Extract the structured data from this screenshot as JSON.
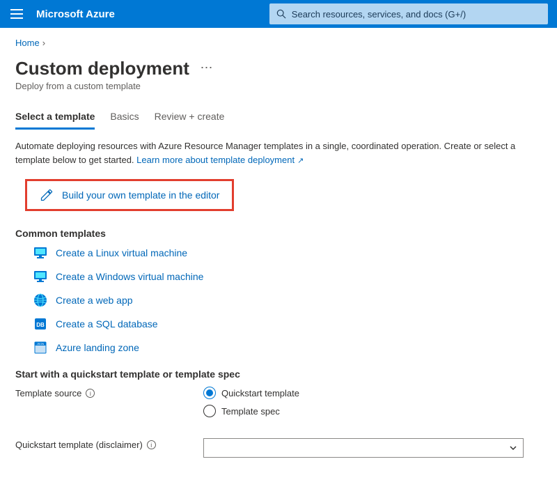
{
  "header": {
    "brand": "Microsoft Azure",
    "search_placeholder": "Search resources, services, and docs (G+/)"
  },
  "breadcrumb": {
    "home": "Home"
  },
  "page": {
    "title": "Custom deployment",
    "subtitle": "Deploy from a custom template"
  },
  "tabs": [
    {
      "label": "Select a template",
      "active": true
    },
    {
      "label": "Basics",
      "active": false
    },
    {
      "label": "Review + create",
      "active": false
    }
  ],
  "intro": {
    "text": "Automate deploying resources with Azure Resource Manager templates in a single, coordinated operation. Create or select a template below to get started.  ",
    "link": "Learn more about template deployment"
  },
  "build_link": "Build your own template in the editor",
  "common_templates_head": "Common templates",
  "templates": [
    {
      "icon": "vm",
      "label": "Create a Linux virtual machine"
    },
    {
      "icon": "vm",
      "label": "Create a Windows virtual machine"
    },
    {
      "icon": "web",
      "label": "Create a web app"
    },
    {
      "icon": "sql",
      "label": "Create a SQL database"
    },
    {
      "icon": "zone",
      "label": "Azure landing zone"
    }
  ],
  "quickstart_head": "Start with a quickstart template or template spec",
  "form": {
    "source_label": "Template source",
    "source_options": [
      {
        "label": "Quickstart template",
        "checked": true
      },
      {
        "label": "Template spec",
        "checked": false
      }
    ],
    "quickstart_label": "Quickstart template (disclaimer)"
  }
}
